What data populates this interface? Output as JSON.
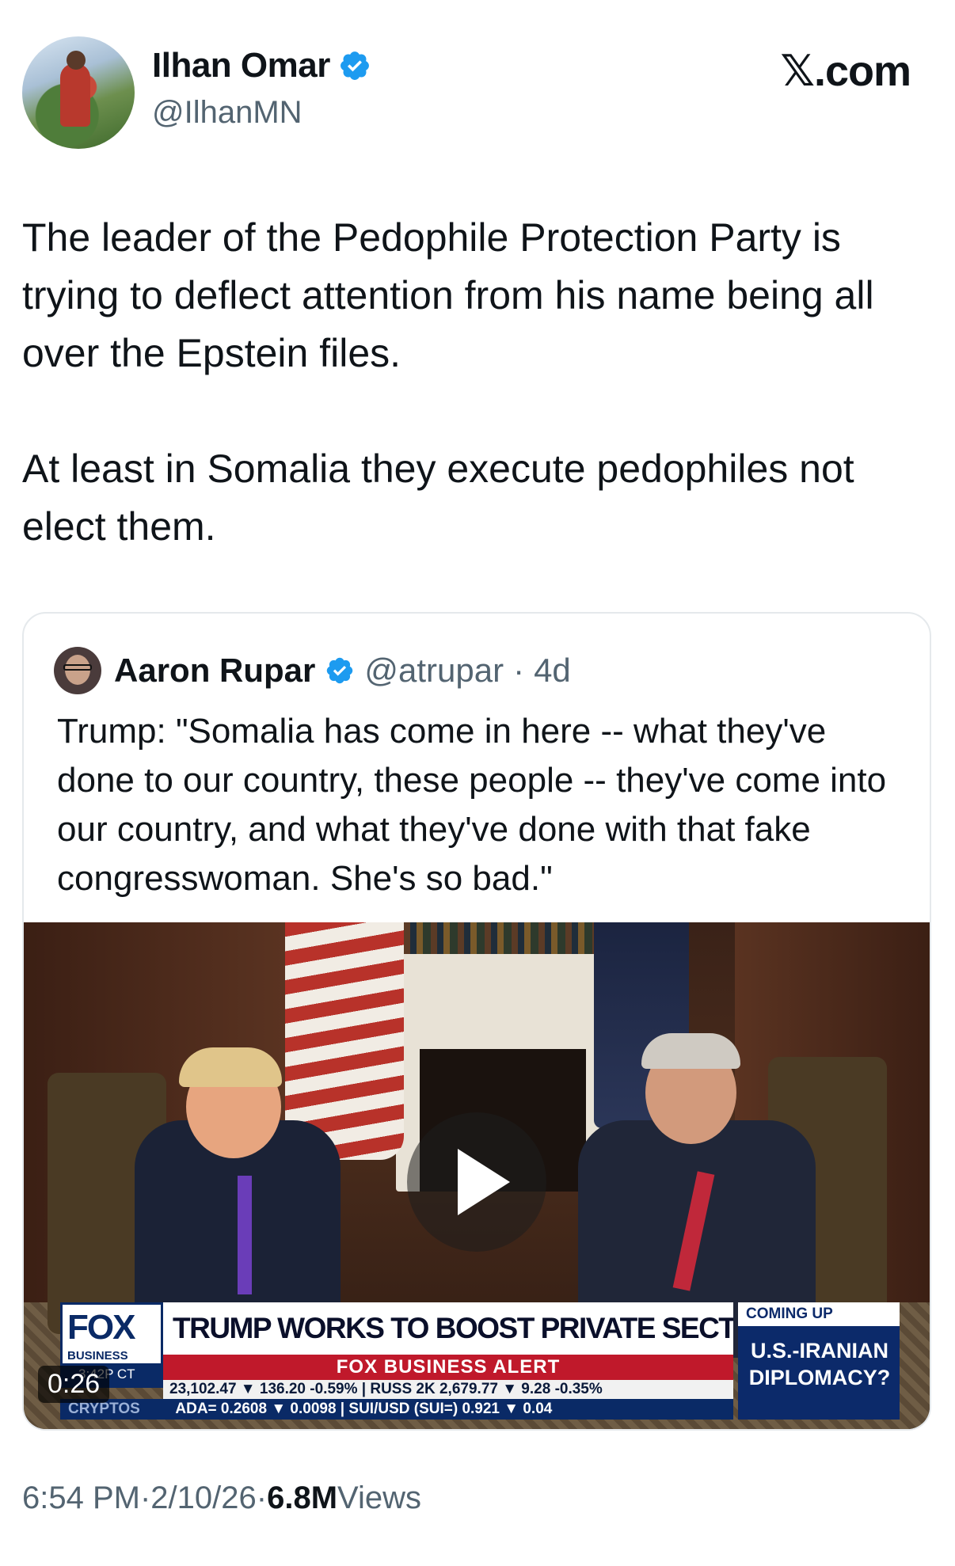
{
  "author": {
    "display_name": "Ilhan Omar",
    "handle": "@IlhanMN"
  },
  "watermark": "𝕏.com",
  "post": {
    "paragraphs": [
      "The leader of the Pedophile Protection Party is trying to deflect attention from his name being all over the Epstein files.",
      "At least in Somalia they execute pedophiles not elect them."
    ]
  },
  "quoted": {
    "display_name": "Aaron Rupar",
    "handle": "@atrupar",
    "separator": "·",
    "time": "4d",
    "text": "Trump: \"Somalia has come in here -- what they've done to our country, these people -- they've come into our country, and what they've done with that fake congresswoman. She's so bad.\"",
    "video": {
      "duration": "0:26",
      "chyron": {
        "logo": "FOX",
        "logo_sub": "BUSINESS",
        "clock": "3:42P CT",
        "headline": "TRUMP WORKS TO BOOST PRIVATE SECTOR IN SECOND TERM",
        "alert": "FOX BUSINESS ALERT",
        "ticker_top": "23,102.47 ▼ 136.20 -0.59% | RUSS 2K   2,679.77 ▼ 9.28 -0.35%",
        "ticker_label": "CRYPTOS",
        "ticker_bottom": "ADA= 0.2608 ▼ 0.0098 | SUI/USD (SUI=) 0.921 ▼ 0.04",
        "coming_up_label": "COMING UP",
        "coming_up_topic": "U.S.-IRANIAN DIPLOMACY?"
      }
    }
  },
  "meta": {
    "time": "6:54 PM",
    "sep1": " · ",
    "date": "2/10/26",
    "sep2": " · ",
    "views_count": "6.8M",
    "views_label": " Views"
  },
  "colors": {
    "verified": "#1d9bf0",
    "text_primary": "#0f1419",
    "text_secondary": "#536471",
    "border": "#e5e9ec"
  },
  "icons": {
    "verified": "verified-badge-icon",
    "play": "play-icon"
  }
}
